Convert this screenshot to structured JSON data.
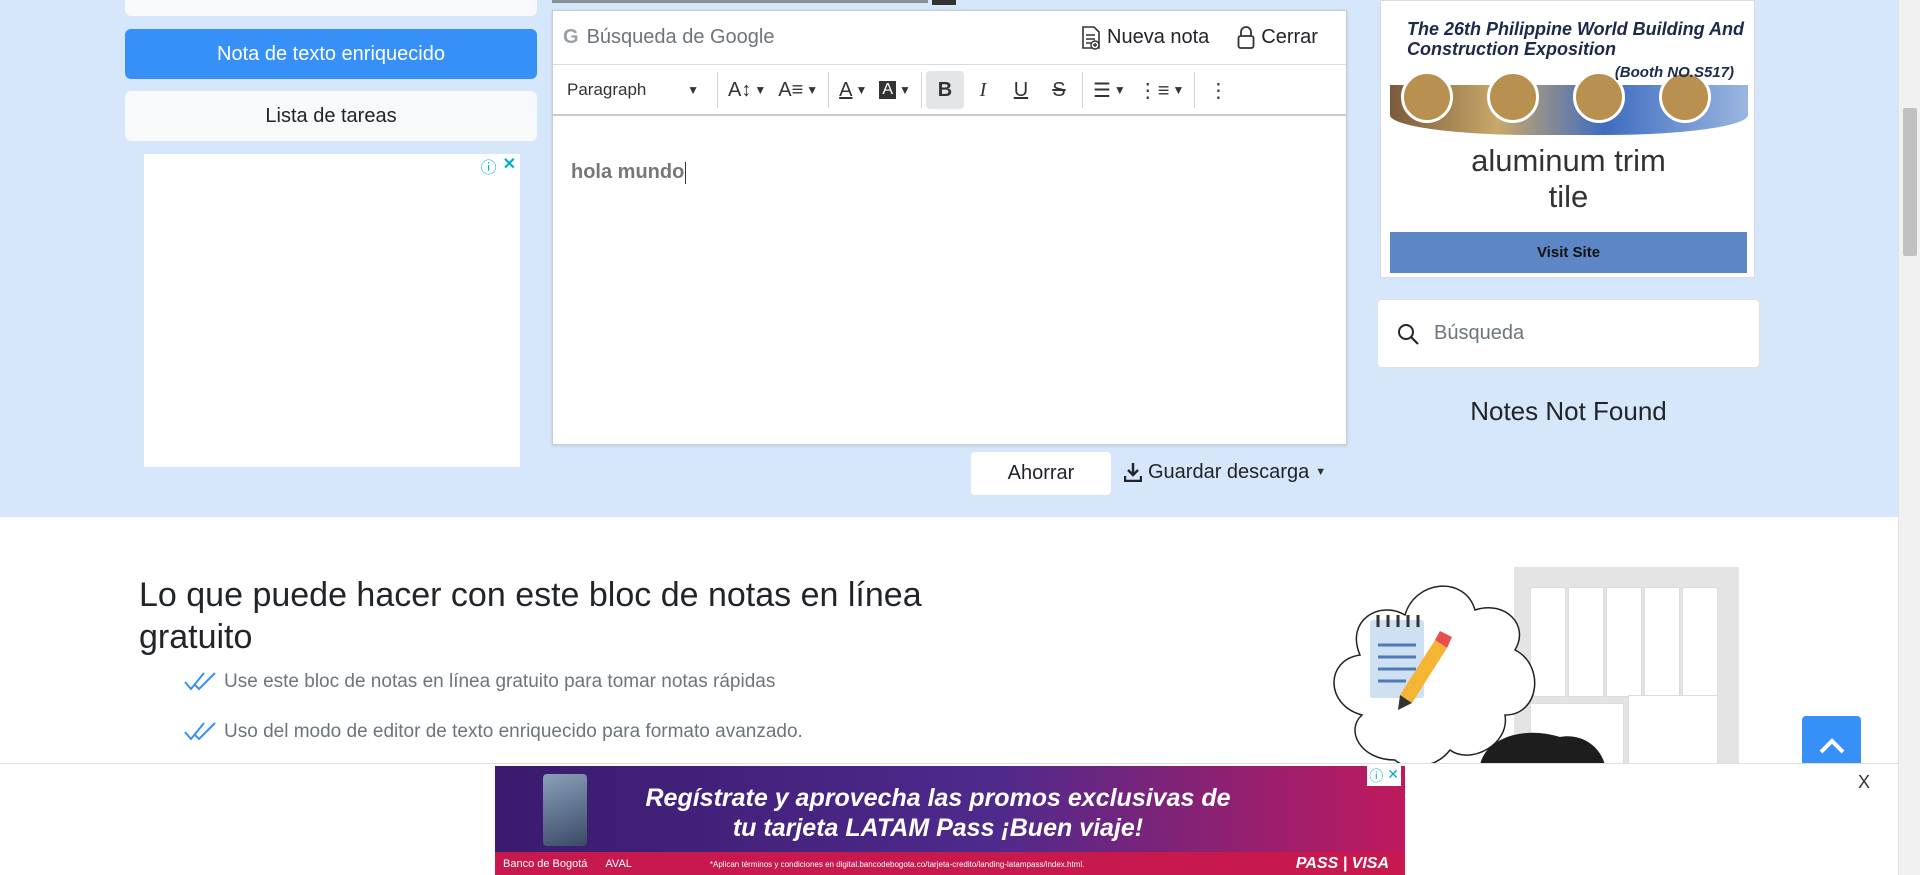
{
  "left": {
    "rich_text_button": "Nota de texto enriquecido",
    "task_list_button": "Lista de tareas"
  },
  "editor": {
    "google_search_placeholder": "Búsqueda de Google",
    "new_note_label": "Nueva nota",
    "close_label": "Cerrar",
    "paragraph_select": "Paragraph",
    "content": "hola mundo",
    "save_button": "Ahorrar",
    "download_button": "Guardar descarga"
  },
  "right": {
    "ad_title": "The 26th Philippine World Building And Construction Exposition",
    "ad_booth": "(Booth NO.S517)",
    "ad_headline_line1": "aluminum trim",
    "ad_headline_line2": "tile",
    "ad_cta": "Visit Site",
    "search_placeholder": "Búsqueda",
    "notes_status": "Notes Not Found"
  },
  "content": {
    "section_title": "Lo que puede hacer con este bloc de notas en línea gratuito",
    "features": [
      "Use este bloc de notas en línea gratuito para tomar notas rápidas",
      "Uso del modo de editor de texto enriquecido para formato avanzado."
    ]
  },
  "bottom_ad": {
    "close_label": "X",
    "headline": "Regístrate y aprovecha las promos exclusivas de tu tarjeta LATAM Pass ¡Buen viaje!",
    "bank": "Banco de Bogotá",
    "group": "AVAL",
    "fine_print": "*Aplican términos y condiciones en digital.bancodebogota.co/tarjeta-credito/landing-latampass/index.html.",
    "partner": "PASS",
    "network": "VISA"
  },
  "colors": {
    "accent": "#3690f8",
    "band": "#d6e6fb"
  }
}
